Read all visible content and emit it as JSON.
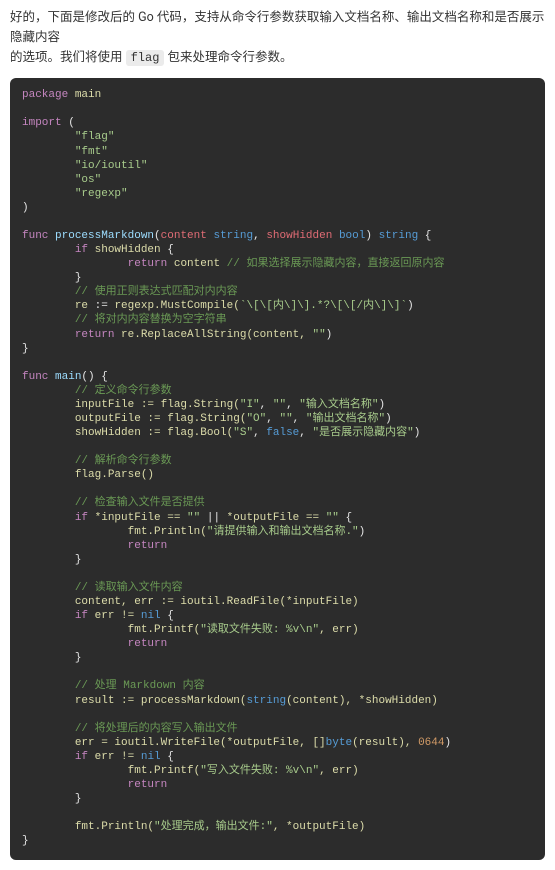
{
  "intro": {
    "line1_a": "好的，下面是修改后的 Go 代码，支持从命令行参数获取输入文档名称、输出文档名称和是否展示隐藏内容",
    "line2_a": "的选项。我们将使用 ",
    "flag_code": "flag",
    "line2_b": " 包来处理命令行参数。"
  },
  "code": {
    "kw_package": "package",
    "id_main": "main",
    "kw_import": "import",
    "lparen": "(",
    "rparen": ")",
    "imp_flag": "\"flag\"",
    "imp_fmt": "\"fmt\"",
    "imp_ioutil": "\"io/ioutil\"",
    "imp_os": "\"os\"",
    "imp_regexp": "\"regexp\"",
    "kw_func": "func",
    "fn_processMarkdown": "processMarkdown",
    "param_content": "content",
    "ty_string": "string",
    "param_showHidden": "showHidden",
    "ty_bool": "bool",
    "lbrace": "{",
    "rbrace": "}",
    "kw_if": "if",
    "kw_return": "return",
    "cmt_returnOriginal": "// 如果选择展示隐藏内容，直接返回原内容",
    "cmt_useRegex": "// 使用正则表达式匹配对内内容",
    "assign": ":=",
    "regexp_MustCompile": "regexp.MustCompile(",
    "regex_literal": "`\\[\\[内\\]\\].*?\\[\\[/内\\]\\]`",
    "close_paren": ")",
    "cmt_replaceEmpty": "// 将对内内容替换为空字符串",
    "re_ReplaceAllString": "re.ReplaceAllString(content, ",
    "empty_str": "\"\"",
    "fn_main": "main",
    "emptyParens": "()",
    "cmt_defineFlags": "// 定义命令行参数",
    "inputFile_lhs": "inputFile := flag.String(",
    "flag_I": "\"I\"",
    "comma": ", ",
    "flag_I_desc": "\"输入文档名称\"",
    "outputFile_lhs": "outputFile := flag.String(",
    "flag_O": "\"O\"",
    "flag_O_desc": "\"输出文档名称\"",
    "showHidden_lhs": "showHidden := flag.Bool(",
    "flag_S": "\"S\"",
    "lit_false": "false",
    "flag_S_desc": "\"是否展示隐藏内容\"",
    "cmt_parseFlags": "// 解析命令行参数",
    "flag_Parse": "flag.Parse()",
    "cmt_checkInput": "// 检查输入文件是否提供",
    "if_input_empty_a": "*inputFile == ",
    "or": " || ",
    "if_output_empty_a": "*outputFile == ",
    "println_open": "fmt.Println(",
    "msg_provide": "\"请提供输入和输出文档名称.\"",
    "cmt_readInput": "// 读取输入文件内容",
    "read_lhs": "content, err := ioutil.ReadFile(*inputFile)",
    "err_ne_nil": "err != ",
    "lit_nil": "nil",
    "printf_open": "fmt.Printf(",
    "msg_readfail": "\"读取文件失败: %v\\n\"",
    "err_arg": ", err)",
    "cmt_process": "// 处理 Markdown 内容",
    "result_lhs": "result := processMarkdown(",
    "cast_string": "string",
    "content_close": "(content), *showHidden)",
    "cmt_writeOut": "// 将处理后的内容写入输出文件",
    "write_lhs": "err = ioutil.WriteFile(*outputFile, []",
    "ty_byte": "byte",
    "write_args": "(result), ",
    "perm": "0644",
    "msg_writefail": "\"写入文件失败: %v\\n\"",
    "msg_done": "\"处理完成，输出文件:\"",
    "done_arg": ", *outputFile)"
  }
}
